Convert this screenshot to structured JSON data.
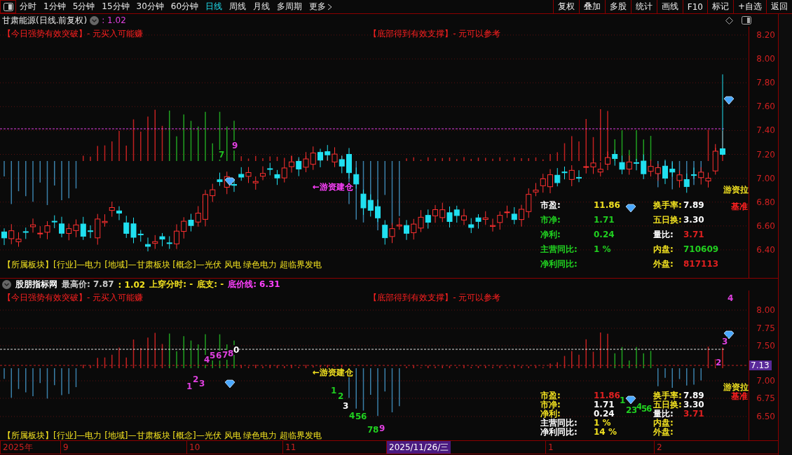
{
  "toolbar": {
    "periods": [
      {
        "label": "分时",
        "selected": false
      },
      {
        "label": "1分钟",
        "selected": false
      },
      {
        "label": "5分钟",
        "selected": false
      },
      {
        "label": "15分钟",
        "selected": false
      },
      {
        "label": "30分钟",
        "selected": false
      },
      {
        "label": "60分钟",
        "selected": false
      },
      {
        "label": "日线",
        "selected": true
      },
      {
        "label": "周线",
        "selected": false
      },
      {
        "label": "月线",
        "selected": false
      },
      {
        "label": "多周期",
        "selected": false
      },
      {
        "label": "更多",
        "selected": false
      }
    ],
    "actions": [
      "复权",
      "叠加",
      "多股",
      "统计",
      "画线",
      "F10",
      "标记",
      "+自选",
      "返回"
    ]
  },
  "main_panel": {
    "title": "甘肃能源(日线.前复权)",
    "value": ": 1.02",
    "signals": [
      "【今日强势有效突破】- 元买入可能赚",
      "【底部得到有效支撑】- 元可以参考"
    ],
    "price_ticks": [
      "8.20",
      "8.00",
      "7.80",
      "7.60",
      "7.40",
      "7.20",
      "7.00",
      "6.80",
      "6.60",
      "6.40"
    ],
    "annotations": [
      {
        "text": "7",
        "color": "#20c020"
      },
      {
        "text": "9",
        "color": "#e040e0"
      },
      {
        "text": "←游资建仓",
        "color": "#ff40ff"
      },
      {
        "text": "游资拉",
        "color": "#f0e020"
      },
      {
        "text": "基准",
        "color": "#ff2020"
      }
    ],
    "stats": [
      {
        "label": {
          "text": "市盈:",
          "color": "#ffffff"
        },
        "value": {
          "text": "11.86",
          "color": "#f0e020"
        }
      },
      {
        "label": {
          "text": "市净:",
          "color": "#20d020"
        },
        "value": {
          "text": "1.71",
          "color": "#20d020"
        }
      },
      {
        "label": {
          "text": "净利:",
          "color": "#20d020"
        },
        "value": {
          "text": "0.24",
          "color": "#20d020"
        }
      },
      {
        "label": {
          "text": "主营同比:",
          "color": "#20d020"
        },
        "value": {
          "text": "1 %",
          "color": "#20d020"
        }
      },
      {
        "label": {
          "text": "净利同比:",
          "color": "#20d020"
        }
      },
      {
        "label": {
          "text": "换手率:",
          "color": "#f0e020"
        },
        "value": {
          "text": "7.89",
          "color": "#ffffff"
        }
      },
      {
        "label": {
          "text": "五日换:",
          "color": "#f0e020"
        },
        "value": {
          "text": "3.30",
          "color": "#ffffff"
        }
      },
      {
        "label": {
          "text": "量比:",
          "color": "#ffffff"
        },
        "value": {
          "text": "3.71",
          "color": "#e02020"
        }
      },
      {
        "label": {
          "text": "内盘:",
          "color": "#f0e020"
        },
        "value": {
          "text": "710609",
          "color": "#20d020"
        }
      },
      {
        "label": {
          "text": "外盘:",
          "color": "#f0e020"
        },
        "value": {
          "text": "817113",
          "color": "#e02020"
        }
      }
    ],
    "sectors": "【所属板块】[行业]—电力 [地域]—甘肃板块 [概念]—光伏 风电 绿色电力 超临界发电"
  },
  "sub_panel": {
    "header": [
      {
        "text": "股朋指标网",
        "color": "#ffffff"
      },
      {
        "text": "最高价: 7.87",
        "color": "#c8c8c8"
      },
      {
        "text": ": 1.02",
        "color": "#f0e020"
      },
      {
        "text": "上穿分时: -",
        "color": "#f0e020"
      },
      {
        "text": "底支: -",
        "color": "#f0e020"
      },
      {
        "text": "底价线: 6.31",
        "color": "#ff40ff"
      }
    ],
    "signals": [
      "【今日强势有效突破】- 元买入可能赚",
      "【底部得到有效支撑】- 元可以参考"
    ],
    "price_ticks": [
      "8.00",
      "7.75",
      "7.50",
      "7.00",
      "6.75",
      "6.50"
    ],
    "current_price": "7.13",
    "annotations": [
      {
        "text": "1",
        "color": "#e040e0"
      },
      {
        "text": "2",
        "color": "#e040e0"
      },
      {
        "text": "3",
        "color": "#e040e0"
      },
      {
        "text": "4",
        "color": "#e040e0"
      },
      {
        "text": "5",
        "color": "#e040e0"
      },
      {
        "text": "6",
        "color": "#e040e0"
      },
      {
        "text": "7",
        "color": "#e040e0"
      },
      {
        "text": "8",
        "color": "#e040e0"
      },
      {
        "text": "0",
        "color": "#ffffff"
      },
      {
        "text": "←游资建仓",
        "color": "#f0e020"
      },
      {
        "text": "1",
        "color": "#20d020"
      },
      {
        "text": "2",
        "color": "#20d020"
      },
      {
        "text": "3",
        "color": "#ffffff"
      },
      {
        "text": "4",
        "color": "#20d020"
      },
      {
        "text": "5",
        "color": "#20d020"
      },
      {
        "text": "6",
        "color": "#20d020"
      },
      {
        "text": "7",
        "color": "#20d020"
      },
      {
        "text": "8",
        "color": "#20d020"
      },
      {
        "text": "9",
        "color": "#e040e0"
      },
      {
        "text": "1",
        "color": "#20d020"
      },
      {
        "text": "2",
        "color": "#20d020"
      },
      {
        "text": "3",
        "color": "#20d020"
      },
      {
        "text": "4",
        "color": "#20d020"
      },
      {
        "text": "5",
        "color": "#20d020"
      },
      {
        "text": "6",
        "color": "#20d020"
      },
      {
        "text": "2",
        "color": "#e040e0"
      },
      {
        "text": "3",
        "color": "#e040e0"
      },
      {
        "text": "4",
        "color": "#e040e0"
      },
      {
        "text": "游资拉",
        "color": "#f0e020"
      },
      {
        "text": "基准",
        "color": "#ff2020"
      }
    ],
    "stats": [
      {
        "label": {
          "text": "市盈:",
          "color": "#f0e020"
        },
        "value": {
          "text": "11.86",
          "color": "#e02020"
        }
      },
      {
        "label": {
          "text": "市净:",
          "color": "#f0e020"
        },
        "value": {
          "text": "1.71",
          "color": "#ffffff"
        }
      },
      {
        "label": {
          "text": "净利:",
          "color": "#f0e020"
        },
        "value": {
          "text": "0.24",
          "color": "#ffffff"
        }
      },
      {
        "label": {
          "text": "主营同比:",
          "color": "#ffffff"
        },
        "value": {
          "text": "1 %",
          "color": "#f0e020"
        }
      },
      {
        "label": {
          "text": "净利同比:",
          "color": "#ffffff"
        },
        "value": {
          "text": "14 %",
          "color": "#f0e020"
        }
      },
      {
        "label": {
          "text": "换手率:",
          "color": "#f0e020"
        },
        "value": {
          "text": "7.89",
          "color": "#ffffff"
        }
      },
      {
        "label": {
          "text": "五日换:",
          "color": "#f0e020"
        },
        "value": {
          "text": "3.30",
          "color": "#ffffff"
        }
      },
      {
        "label": {
          "text": "量比:",
          "color": "#ffffff"
        },
        "value": {
          "text": "3.71",
          "color": "#e02020"
        }
      },
      {
        "label": {
          "text": "内盘:",
          "color": "#f0e020"
        }
      },
      {
        "label": {
          "text": "外盘:",
          "color": "#f0e020"
        }
      }
    ],
    "sectors": "【所属板块】[行业]—电力 [地域]—甘肃板块 [概念]—光伏 风电 绿色电力 超临界发电"
  },
  "time_axis": [
    {
      "label": "2025年",
      "selected": false
    },
    {
      "label": "9",
      "selected": false
    },
    {
      "label": "10",
      "selected": false
    },
    {
      "label": "11",
      "selected": false
    },
    {
      "label": "2025/11/26/三",
      "selected": true
    },
    {
      "label": "1",
      "selected": false
    },
    {
      "label": "2",
      "selected": false
    }
  ]
}
